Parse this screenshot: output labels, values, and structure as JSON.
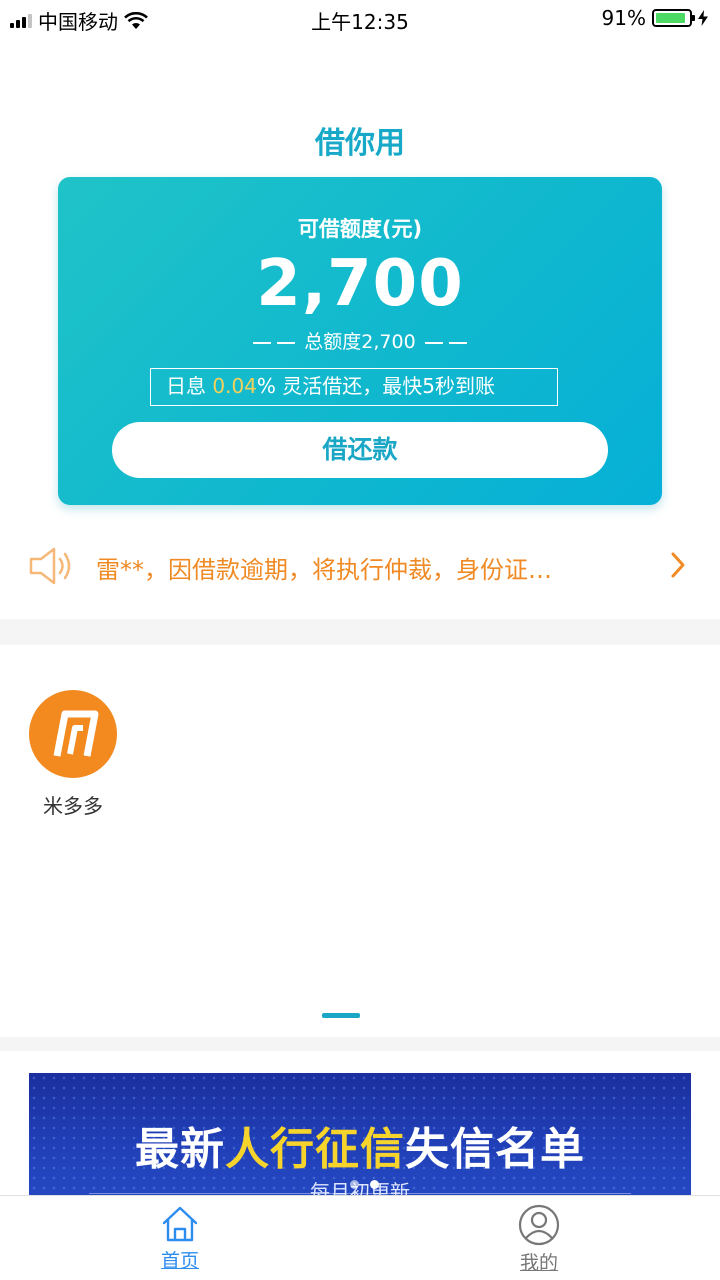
{
  "status_bar": {
    "carrier": "中国移动",
    "time": "上午12:35",
    "battery_percent": "91%",
    "battery_level": 0.91
  },
  "header": {
    "title": "借你用"
  },
  "credit_card": {
    "label": "可借额度(元)",
    "amount": "2,700",
    "total": "总额度2,700",
    "info_prefix": "日息 ",
    "info_rate": "0.04",
    "info_suffix": "%   灵活借还，最快5秒到账",
    "button_label": "借还款"
  },
  "notice": {
    "text": "雷**，因借款逾期，将执行仲裁，身份证…",
    "icon": "speaker-icon"
  },
  "apps": [
    {
      "label": "米多多",
      "icon": "midoudou-logo-icon"
    }
  ],
  "banner": {
    "title_part1": "最新",
    "title_highlight": "人行征信",
    "title_part2": "失信名单",
    "subtitle": "每月初更新"
  },
  "tab_bar": {
    "items": [
      {
        "label": "首页",
        "icon": "home-icon",
        "active": true
      },
      {
        "label": "我的",
        "icon": "user-icon",
        "active": false
      }
    ]
  },
  "colors": {
    "accent": "#1aa6c5",
    "notice": "#f08a24",
    "tab_active": "#2d8cf0",
    "rate_highlight": "#f4d15a"
  }
}
